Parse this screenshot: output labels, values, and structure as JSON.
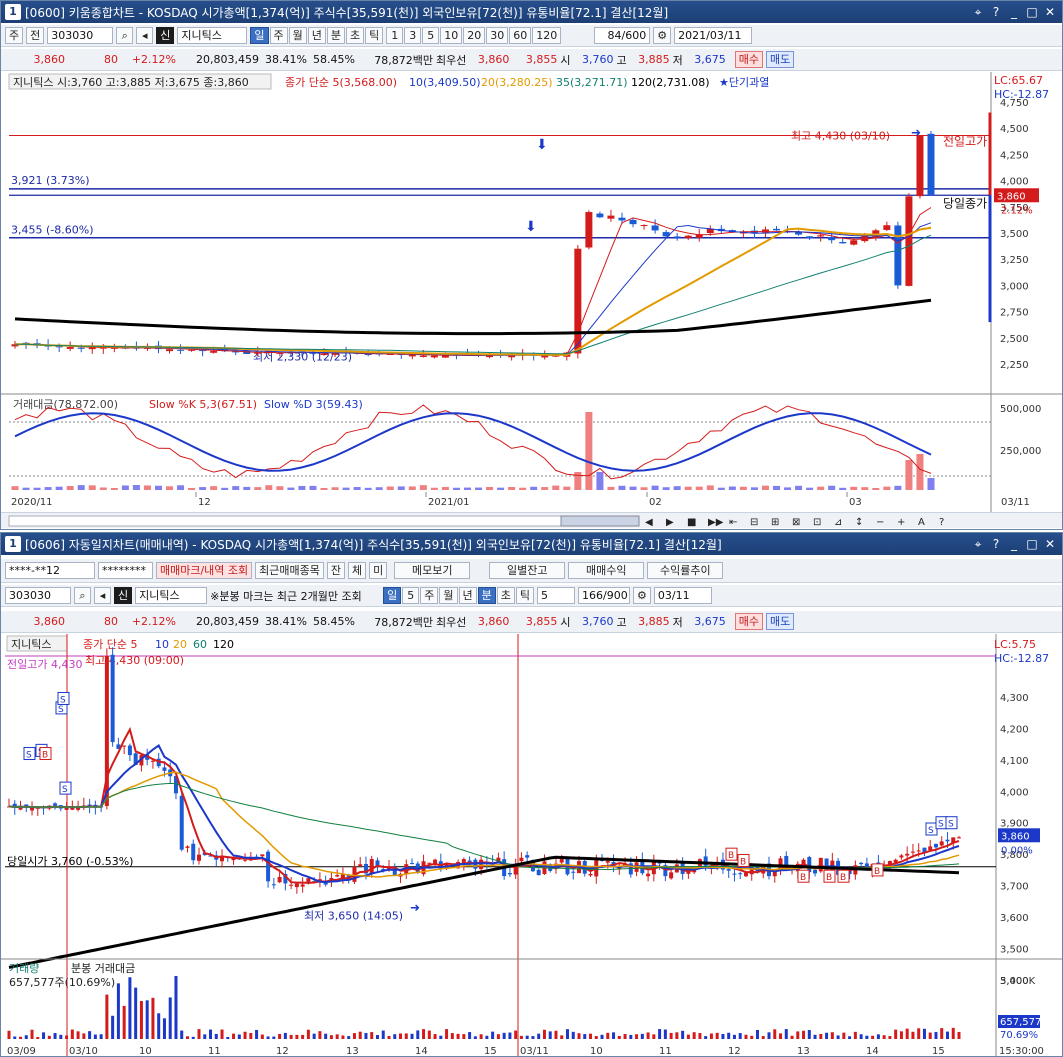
{
  "top": {
    "title": "[0600] 키움종합차트 - KOSDAQ 시가총액[1,374(억)] 주식수[35,591(천)] 외국인보유[72(천)] 유통비율[72.1] 결산[12월]",
    "window_num": "1",
    "toolbar1": {
      "type1": "주",
      "type2": "전",
      "code": "303030",
      "name_tag": "신",
      "name": "지니틱스",
      "periods": [
        "일",
        "주",
        "월",
        "년",
        "분",
        "초",
        "틱"
      ],
      "minutes": [
        "1",
        "3",
        "5",
        "10",
        "20",
        "30",
        "60",
        "120"
      ],
      "count": "84/600",
      "date": "2021/03/11"
    },
    "toolbar2": {
      "price": "3,860",
      "change": "80",
      "rate": "+2.12%",
      "volume": "20,803,459",
      "turnover": "38.41%",
      "ratio": "58.45%",
      "amount": "78,872백만",
      "best_label": "최우선",
      "best_ask": "3,860",
      "best_bid": "3,855",
      "open_label": "시",
      "open": "3,760",
      "high_label": "고",
      "high": "3,885",
      "low_label": "저",
      "low": "3,675",
      "buy": "매수",
      "sell": "매도"
    },
    "legend": {
      "stock": "지니틱스 시:3,760 고:3,885 저:3,675 종:3,860",
      "ma_title": "종가 단순 5(3,568.00)",
      "ma10": "10(3,409.50)",
      "ma20": "20(3,280.25)",
      "ma35": "35(3,271.71)",
      "ma120": "120(2,731.08)",
      "short": "★단기과열"
    },
    "annotations": {
      "hline1": "3,921 (3.73%)",
      "hline2": "3,455 (-8.60%)",
      "high_marker": "최고 4,430 (03/10)",
      "low_marker": "최저 2,330 (12/23)",
      "prev_high": "전일고가",
      "today_close": "당일종가",
      "lc": "LC:65.67",
      "hc": "HC:-12.87",
      "cur_price": "3,860",
      "cur_rate": "2.12%"
    },
    "y_ticks": [
      "4,750",
      "4,500",
      "4,250",
      "4,000",
      "3,750",
      "3,500",
      "3,250",
      "3,000",
      "2,750",
      "2,500",
      "2,250"
    ],
    "lower_legend": {
      "amount": "거래대금(78,872.00)",
      "k": "Slow %K 5,3(67.51)",
      "d": "Slow %D 3(59.43)"
    },
    "lower_ticks": [
      "500,000",
      "250,000"
    ],
    "x_labels": [
      "2020/11",
      "12",
      "2021/01",
      "02",
      "03"
    ],
    "x_right": "03/11"
  },
  "bottom": {
    "title": "[0606] 자동일지차트(매매내역) - KOSDAQ 시가총액[1,374(억)] 주식수[35,591(천)] 외국인보유[72(천)] 유통비율[72.1] 결산[12월]",
    "window_num": "1",
    "toolbar1": {
      "account": "****-**12",
      "password": "********",
      "btn_mark": "매매마크/내역 조회",
      "btn_recent": "최근매매종목",
      "btn_j": "잔",
      "btn_c": "체",
      "btn_m": "미",
      "btn_memo": "메모보기",
      "btn_daily": "일별잔고",
      "btn_profit": "매매수익",
      "btn_trend": "수익률추이"
    },
    "toolbar2": {
      "code": "303030",
      "name_tag": "신",
      "name": "지니틱스",
      "note": "※분봉 마크는 최근 2개월만 조회",
      "periods": [
        "일",
        "5",
        "주",
        "월",
        "년",
        "분",
        "초",
        "틱"
      ],
      "minute": "5",
      "count": "166/900",
      "date": "03/11"
    },
    "toolbar3": {
      "price": "3,860",
      "change": "80",
      "rate": "+2.12%",
      "volume": "20,803,459",
      "turnover": "38.41%",
      "ratio": "58.45%",
      "amount": "78,872백만",
      "best_label": "최우선",
      "best_ask": "3,860",
      "best_bid": "3,855",
      "open_label": "시",
      "open": "3,760",
      "high_label": "고",
      "high": "3,885",
      "low_label": "저",
      "low": "3,675",
      "buy": "매수",
      "sell": "매도"
    },
    "legend": {
      "stock": "지니틱스",
      "ma_title": "종가 단순 5",
      "ma10": "10",
      "ma20": "20",
      "ma60": "60",
      "ma120": "120"
    },
    "annotations": {
      "prev_high": "전일고가 4,430",
      "high_marker": "최고 4,430 (09:00)",
      "open_line": "당일시가 3,760 (-0.53%)",
      "low_marker": "최저 3,650 (14:05)",
      "lc": "LC:5.75",
      "hc": "HC:-12.87",
      "cur_price": "3,860",
      "cur_rate": "0.00%"
    },
    "y_ticks": [
      "4,300",
      "4,200",
      "4,100",
      "4,000",
      "3,900",
      "3,800",
      "3,700",
      "3,600",
      "3,500",
      "3,400"
    ],
    "lower_legend": {
      "vol": "거래량",
      "amt": "분봉 거래대금",
      "vol_val": "657,577주(10.69%)"
    },
    "lower_ticks": [
      "5,000K"
    ],
    "lower_right": {
      "vol": "657,577",
      "pct": "70.69%"
    },
    "x_labels": [
      "03/09",
      "03/10",
      "10",
      "11",
      "12",
      "13",
      "14",
      "15",
      "03/11",
      "10",
      "11",
      "12",
      "13",
      "14",
      "15"
    ],
    "x_right": "15:30:00"
  }
}
